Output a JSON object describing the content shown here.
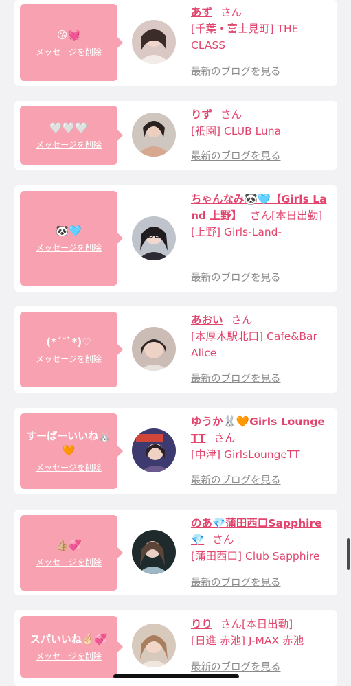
{
  "suffix": "さん",
  "delete_label": "メッセージを削除",
  "blog_label": "最新のブログを見る",
  "accent_color": "#e1456e",
  "bubble_color": "#f7a1b1",
  "cards": [
    {
      "message": "😘💓",
      "name": "あず",
      "extra": "",
      "shop": "[千葉・富士見町] THE CLASS",
      "avatar_icon": "portrait-photo"
    },
    {
      "message": "🤍🤍🤍",
      "name": "りず",
      "extra": "",
      "shop": "[祇園] CLUB Luna",
      "avatar_icon": "portrait-photo"
    },
    {
      "message": "🐼🩵",
      "name": "ちゃんなみ🐼🩵【Girls Land 上野】",
      "extra": "[本日出勤]",
      "shop": "[上野] Girls-Land-",
      "avatar_icon": "portrait-photo"
    },
    {
      "message": "(*´˘`*)♡",
      "name": "あおい",
      "extra": "",
      "shop": "[本厚木駅北口] Cafe&Bar Alice",
      "avatar_icon": "portrait-photo"
    },
    {
      "message": "すーぱーいいね🐰🧡",
      "name": "ゆうか🐰🧡Girls Lounge TT",
      "extra": "",
      "shop": "[中津] GirlsLoungeTT",
      "avatar_icon": "portrait-photo"
    },
    {
      "message": "👍🏼💞",
      "name": "のあ💎蒲田西口Sapphire💎",
      "extra": "",
      "shop": "[蒲田西口] Club Sapphire",
      "avatar_icon": "portrait-photo"
    },
    {
      "message": "スパいいね🤞🏻💞",
      "name": "りり",
      "extra": "[本日出勤]",
      "shop": "[日進 赤池] J-MAX 赤池",
      "avatar_icon": "portrait-photo"
    }
  ]
}
